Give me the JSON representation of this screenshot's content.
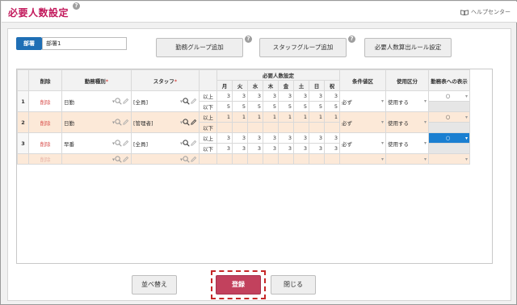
{
  "header": {
    "title": "必要人数設定",
    "help_center": "ヘルプセンター"
  },
  "dept": {
    "label": "部署",
    "value": "部署1"
  },
  "toolbar": {
    "add_work_group": "勤務グループ追加",
    "add_staff_group": "スタッフグループ追加",
    "rule_settings": "必要人数算出ルール設定",
    "help_mark": "?"
  },
  "table": {
    "headers": {
      "delete": "削除",
      "shift_type": "勤務種別",
      "staff": "スタッフ",
      "required_group": "必要人数設定",
      "days": [
        "月",
        "火",
        "水",
        "木",
        "金",
        "土",
        "日",
        "祝"
      ],
      "condition": "条件値区",
      "usage": "使用区分",
      "display": "勤務表への表示",
      "required_mark": "*"
    },
    "rows": [
      {
        "num": "1",
        "delete": "削除",
        "shift": "日勤",
        "staff": "[全員]",
        "upper_label": "以上",
        "lower_label": "以下",
        "upper": [
          "3",
          "3",
          "3",
          "3",
          "3",
          "3",
          "3",
          "3"
        ],
        "lower": [
          "5",
          "5",
          "5",
          "5",
          "5",
          "5",
          "5",
          "5"
        ],
        "condition": "必ず",
        "usage": "使用する",
        "display": "○"
      },
      {
        "num": "2",
        "delete": "削除",
        "shift": "日勤",
        "staff": "[管理者]",
        "upper_label": "以上",
        "lower_label": "以下",
        "upper": [
          "1",
          "1",
          "1",
          "1",
          "1",
          "1",
          "1",
          "1"
        ],
        "lower": [
          "",
          "",
          "",
          "",
          "",
          "",
          "",
          ""
        ],
        "condition": "必ず",
        "usage": "使用する",
        "display": "○"
      },
      {
        "num": "3",
        "delete": "削除",
        "shift": "早番",
        "staff": "[全員]",
        "upper_label": "以上",
        "lower_label": "以下",
        "upper": [
          "3",
          "3",
          "3",
          "3",
          "3",
          "3",
          "3",
          "3"
        ],
        "lower": [
          "3",
          "3",
          "3",
          "3",
          "3",
          "3",
          "3",
          "3"
        ],
        "condition": "必ず",
        "usage": "使用する",
        "display": "○"
      }
    ],
    "new_row": {
      "delete": "削除"
    }
  },
  "footer": {
    "sort": "並べ替え",
    "register": "登録",
    "close": "閉じる"
  },
  "colors": {
    "title": "#c2185b",
    "dept_label": "#1f6fb5",
    "register": "#c2415d",
    "highlight": "#c62828",
    "row_alt": "#fce9d8",
    "selected_cell": "#1a7fd1"
  }
}
